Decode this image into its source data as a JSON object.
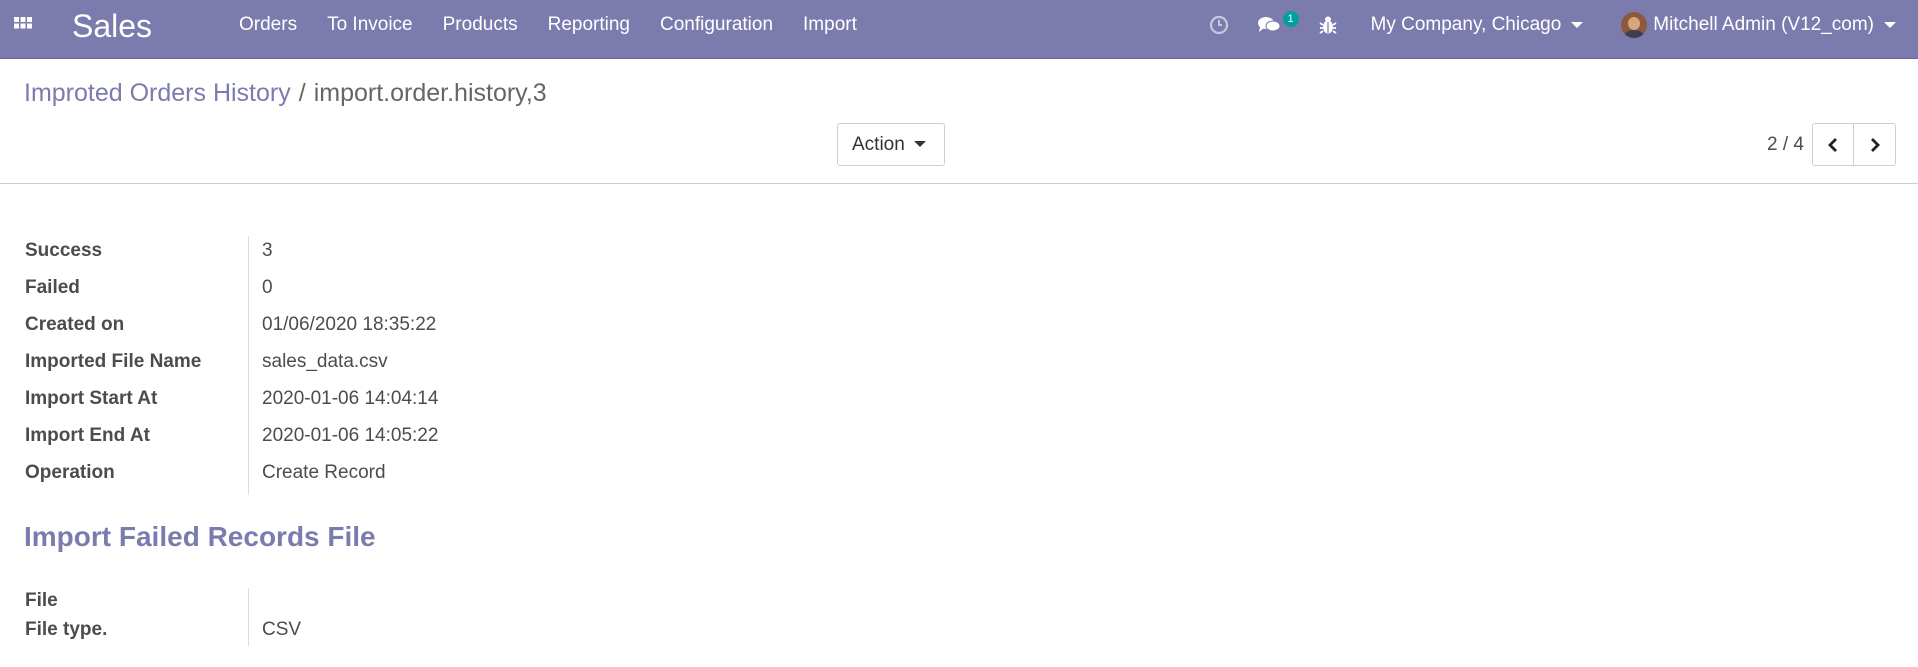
{
  "navbar": {
    "app_name": "Sales",
    "menu": [
      "Orders",
      "To Invoice",
      "Products",
      "Reporting",
      "Configuration",
      "Import"
    ],
    "messages_count": "1",
    "company": "My Company, Chicago",
    "user": "Mitchell Admin (V12_com)"
  },
  "breadcrumb": {
    "parent": "Improted Orders History",
    "separator": "/",
    "current": "import.order.history,3"
  },
  "toolbar": {
    "action_label": "Action"
  },
  "pager": {
    "value": "2 / 4"
  },
  "record": {
    "fields": [
      {
        "label": "Success",
        "value": "3"
      },
      {
        "label": "Failed",
        "value": "0"
      },
      {
        "label": "Created on",
        "value": "01/06/2020 18:35:22"
      },
      {
        "label": "Imported File Name",
        "value": "sales_data.csv"
      },
      {
        "label": "Import Start At",
        "value": "2020-01-06 14:04:14"
      },
      {
        "label": "Import End At",
        "value": "2020-01-06 14:05:22"
      },
      {
        "label": "Operation",
        "value": "Create Record"
      }
    ],
    "section_title": "Import Failed Records File",
    "file_fields": [
      {
        "label": "File",
        "value": ""
      },
      {
        "label": "File type.",
        "value": "CSV"
      }
    ]
  },
  "colors": {
    "brand": "#7c7bad",
    "badge": "#00a09d"
  }
}
